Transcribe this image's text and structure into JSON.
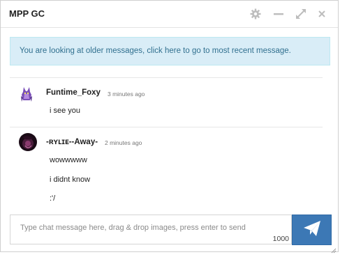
{
  "window": {
    "title": "MPP GC"
  },
  "header_icons": [
    "gear-icon",
    "minimize-icon",
    "expand-icon",
    "close-icon"
  ],
  "notice": {
    "text": "You are looking at older messages, click here to go to most recent message."
  },
  "messages": [
    {
      "username": "Funtime_Foxy",
      "timestamp": "3 minutes ago",
      "lines": [
        "i see you"
      ]
    },
    {
      "username": "-ʀʏʟɪᴇ--Away-",
      "timestamp": "2 minutes ago",
      "lines": [
        "wowwwww",
        "i didnt know",
        ":'/"
      ]
    }
  ],
  "composer": {
    "placeholder": "Type chat message here, drag & drop images, press enter to send",
    "char_counter": "1000"
  },
  "colors": {
    "notice_bg": "#d9edf7",
    "notice_text": "#31708f",
    "send_button": "#3c78b5"
  }
}
